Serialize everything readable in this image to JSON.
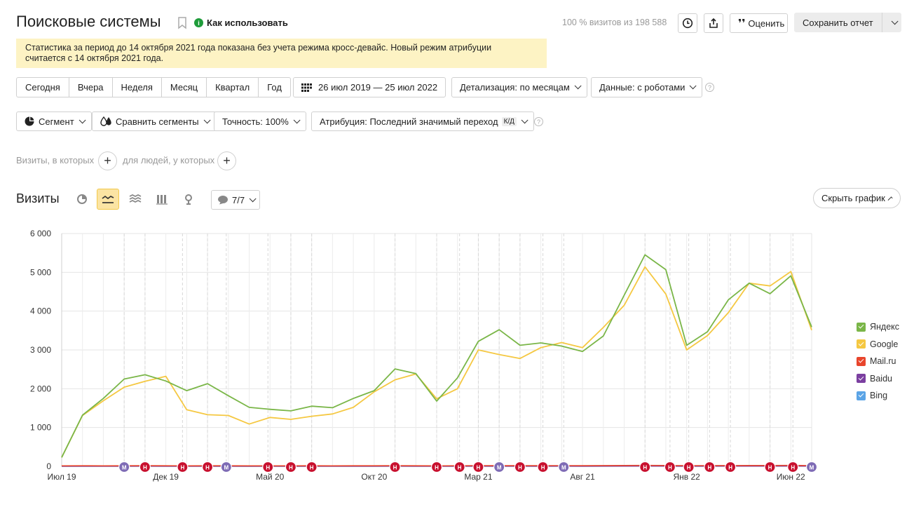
{
  "header": {
    "title": "Поисковые системы",
    "howto": "Как использовать",
    "visits_share": "100 % визитов из 198 588",
    "rate_label": "Оценить",
    "save_label": "Сохранить отчет"
  },
  "notice": {
    "line1": "Статистика за период до 14 октября 2021 года показана без учета режима кросс-девайс. Новый режим атрибуции",
    "line2": "считается с 14 октября 2021 года."
  },
  "period_buttons": [
    "Сегодня",
    "Вчера",
    "Неделя",
    "Месяц",
    "Квартал",
    "Год"
  ],
  "date_range": "26 июл 2019 — 25 июл 2022",
  "detail": "Детализация: по месяцам",
  "data_mode": "Данные: с роботами",
  "segment": "Сегмент",
  "compare": "Сравнить сегменты",
  "accuracy": "Точность: 100%",
  "attribution": "Атрибуция: Последний значимый переход",
  "attribution_badge": "К/Д",
  "filter": {
    "visits_where": "Визиты, в которых",
    "people_where": "для людей, у которых"
  },
  "chart_header": {
    "label": "Визиты",
    "notes_count": "7/7",
    "hide_label": "Скрыть график"
  },
  "colors": {
    "yandex": "#7ab648",
    "google": "#f5c842",
    "mailru": "#e8452c",
    "baidu": "#7b3fa0",
    "bing": "#5ba4e6",
    "grid": "#e5e5e5",
    "marker_red": "#c8102e",
    "marker_purple": "#7e6bb5"
  },
  "chart_data": {
    "type": "line",
    "ylim": [
      0,
      6000
    ],
    "yticks": [
      "6 000",
      "5 000",
      "4 000",
      "3 000",
      "2 000",
      "1 000",
      "0"
    ],
    "xticks": [
      {
        "label": "Июл 19",
        "index": 0
      },
      {
        "label": "Дек 19",
        "index": 5
      },
      {
        "label": "Май 20",
        "index": 10
      },
      {
        "label": "Окт 20",
        "index": 15
      },
      {
        "label": "Мар 21",
        "index": 20
      },
      {
        "label": "Авг 21",
        "index": 25
      },
      {
        "label": "Янв 22",
        "index": 30
      },
      {
        "label": "Июн 22",
        "index": 35
      }
    ],
    "point_count": 37,
    "series": [
      {
        "name": "Яндекс",
        "color": "#7ab648",
        "values": [
          230,
          1320,
          1750,
          2250,
          2360,
          2200,
          1950,
          2130,
          1820,
          1520,
          1470,
          1430,
          1550,
          1510,
          1750,
          1950,
          2510,
          2390,
          1680,
          2280,
          3220,
          3520,
          3120,
          3180,
          3100,
          2960,
          3360,
          4410,
          5450,
          5070,
          3120,
          3470,
          4290,
          4720,
          4450,
          4910,
          3590
        ]
      },
      {
        "name": "Google",
        "color": "#f5c842",
        "values": [
          230,
          1310,
          1690,
          2040,
          2190,
          2320,
          1460,
          1330,
          1310,
          1090,
          1260,
          1210,
          1290,
          1350,
          1520,
          1920,
          2230,
          2380,
          1740,
          2000,
          3000,
          2880,
          2780,
          3060,
          3190,
          3060,
          3580,
          4150,
          5140,
          4440,
          3000,
          3370,
          3960,
          4720,
          4650,
          5020,
          3510
        ]
      },
      {
        "name": "Mail.ru",
        "color": "#e8452c",
        "values": [
          12,
          14,
          13,
          15,
          16,
          14,
          13,
          15,
          14,
          12,
          13,
          12,
          14,
          13,
          15,
          14,
          16,
          15,
          13,
          14,
          18,
          17,
          16,
          17,
          18,
          16,
          19,
          22,
          24,
          21,
          17,
          18,
          20,
          22,
          21,
          23,
          18
        ]
      },
      {
        "name": "Baidu",
        "color": "#7b3fa0",
        "values": [
          3,
          4,
          3,
          4,
          5,
          4,
          3,
          4,
          3,
          3,
          4,
          3,
          3,
          4,
          3,
          4,
          5,
          4,
          3,
          4,
          5,
          4,
          5,
          4,
          5,
          4,
          5,
          6,
          8,
          6,
          4,
          5,
          5,
          6,
          6,
          7,
          5
        ]
      },
      {
        "name": "Bing",
        "color": "#5ba4e6",
        "values": [
          2,
          3,
          3,
          3,
          4,
          3,
          3,
          3,
          3,
          2,
          3,
          2,
          3,
          3,
          3,
          3,
          4,
          3,
          3,
          3,
          4,
          4,
          3,
          4,
          4,
          3,
          4,
          5,
          6,
          5,
          4,
          4,
          5,
          5,
          5,
          6,
          4
        ]
      }
    ],
    "markers": [
      {
        "label": "М",
        "type": "m",
        "at": 3.0
      },
      {
        "label": "Н",
        "type": "n",
        "at": 4.0
      },
      {
        "label": "Н",
        "type": "n",
        "at": 5.8
      },
      {
        "label": "Н",
        "type": "n",
        "at": 7.0
      },
      {
        "label": "М",
        "type": "m",
        "at": 7.9
      },
      {
        "label": "Н",
        "type": "n",
        "at": 9.9
      },
      {
        "label": "Н",
        "type": "n",
        "at": 11.0
      },
      {
        "label": "Н",
        "type": "n",
        "at": 12.0
      },
      {
        "label": "Н",
        "type": "n",
        "at": 16.0
      },
      {
        "label": "Н",
        "type": "n",
        "at": 18.0
      },
      {
        "label": "Н",
        "type": "n",
        "at": 19.1
      },
      {
        "label": "Н",
        "type": "n",
        "at": 20.0
      },
      {
        "label": "М",
        "type": "m",
        "at": 21.0
      },
      {
        "label": "Н",
        "type": "n",
        "at": 22.0
      },
      {
        "label": "Н",
        "type": "n",
        "at": 23.1
      },
      {
        "label": "М",
        "type": "m",
        "at": 24.1
      },
      {
        "label": "Н",
        "type": "n",
        "at": 28.0
      },
      {
        "label": "Н",
        "type": "n",
        "at": 29.2
      },
      {
        "label": "Н",
        "type": "n",
        "at": 30.1
      },
      {
        "label": "Н",
        "type": "n",
        "at": 31.1
      },
      {
        "label": "Н",
        "type": "n",
        "at": 32.1
      },
      {
        "label": "Н",
        "type": "n",
        "at": 34.0
      },
      {
        "label": "Н",
        "type": "n",
        "at": 35.1
      },
      {
        "label": "М",
        "type": "m",
        "at": 36.0
      }
    ]
  }
}
